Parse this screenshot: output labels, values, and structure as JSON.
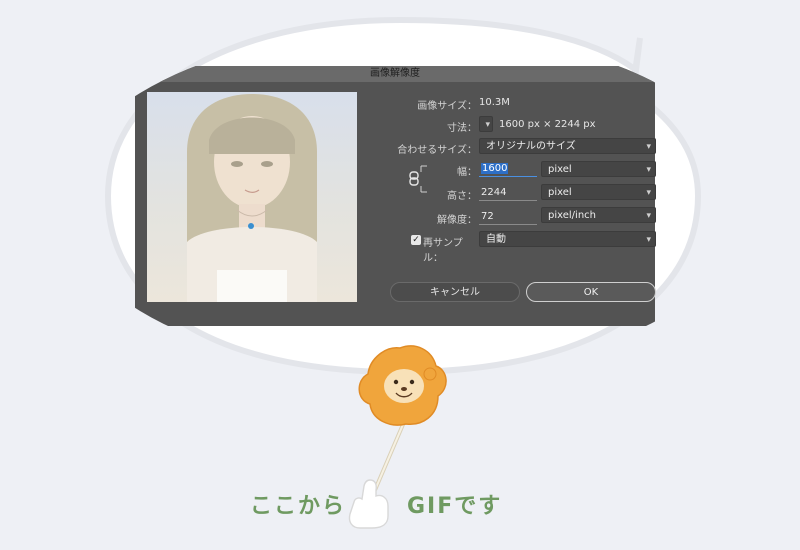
{
  "dialog": {
    "title": "画像解像度",
    "image_size_label": "画像サイズ：",
    "image_size_value": "10.3M",
    "dimensions_label": "寸法：",
    "dimensions_value": "1600 px × 2244 px",
    "fit_to_label": "合わせるサイズ：",
    "fit_to_value": "オリジナルのサイズ",
    "width_label": "幅：",
    "width_value": "1600",
    "width_unit": "pixel",
    "height_label": "高さ：",
    "height_value": "2244",
    "height_unit": "pixel",
    "resolution_label": "解像度：",
    "resolution_value": "72",
    "resolution_unit": "pixel/inch",
    "resample_label": "再サンプル：",
    "resample_checked": true,
    "resample_value": "自動",
    "cancel_label": "キャンセル",
    "ok_label": "OK"
  },
  "caption": {
    "left_text": "ここから",
    "right_text": "GIFです"
  },
  "colors": {
    "dialog_bg": "#535353",
    "caption_green": "#6f9a61",
    "focus_blue": "#2d6fc7",
    "mascot_orange": "#f0a53c"
  },
  "icons": {
    "chain": "link-chain-icon",
    "chevron": "chevron-down-icon",
    "mascot": "lion-mascot-icon",
    "hand": "pointing-glove-icon"
  }
}
